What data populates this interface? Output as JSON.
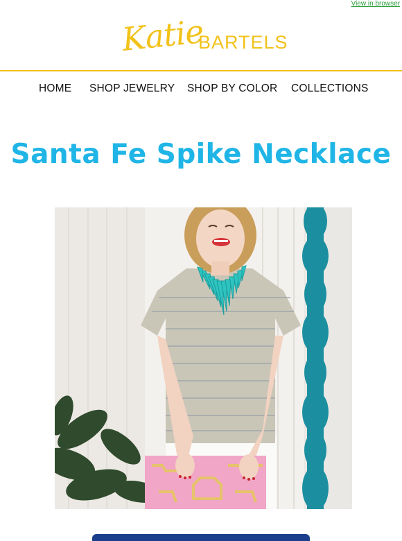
{
  "header": {
    "view_in_browser": "View in browser",
    "logo_script": "Katie",
    "logo_caps": "BARTELS"
  },
  "nav": {
    "items": [
      {
        "label": "HOME"
      },
      {
        "label": "SHOP JEWELRY"
      },
      {
        "label": "SHOP BY COLOR"
      },
      {
        "label": "COLLECTIONS"
      }
    ]
  },
  "main": {
    "title": "Santa Fe Spike Necklace"
  },
  "colors": {
    "brand_yellow": "#f2c21b",
    "title_blue": "#1fb5e6",
    "link_green": "#2a9d3c",
    "button_navy": "#1b3f8c"
  }
}
